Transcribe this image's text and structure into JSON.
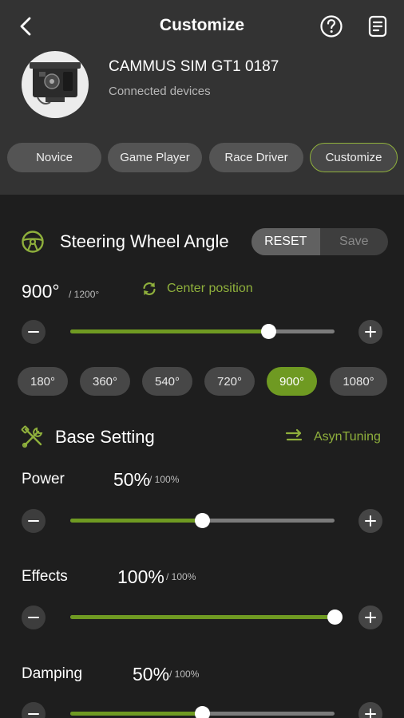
{
  "header": {
    "title": "Customize",
    "device_name": "CAMMUS SIM GT1  0187",
    "device_subtitle": "Connected devices"
  },
  "modes": [
    {
      "label": "Novice",
      "active": false
    },
    {
      "label": "Game Player",
      "active": false
    },
    {
      "label": "Race Driver",
      "active": false
    },
    {
      "label": "Customize",
      "active": true
    }
  ],
  "steering": {
    "title": "Steering Wheel Angle",
    "reset_label": "RESET",
    "save_label": "Save",
    "value": "900°",
    "max": "/ 1200°",
    "center_label": "Center position",
    "slider_value": 900,
    "slider_max": 1200,
    "presets": [
      "180°",
      "360°",
      "540°",
      "720°",
      "900°",
      "1080°"
    ],
    "active_preset": "900°"
  },
  "base": {
    "title": "Base Setting",
    "asyn_label": "AsynTuning",
    "power": {
      "label": "Power",
      "value": "50%",
      "max": "/ 100%",
      "level": 50
    },
    "effects": {
      "label": "Effects",
      "value": "100%",
      "max": "/ 100%",
      "level": 100
    },
    "damping": {
      "label": "Damping",
      "value": "50%",
      "max": "/ 100%",
      "level": 50
    }
  },
  "colors": {
    "accent": "#6f9a22",
    "accent_text": "#8fb03c",
    "header_bg": "#333333",
    "page_bg": "#1e1e1e"
  },
  "icons": [
    "back-icon",
    "help-icon",
    "document-icon",
    "steering-wheel-icon",
    "refresh-icon",
    "tools-icon",
    "swap-icon"
  ]
}
